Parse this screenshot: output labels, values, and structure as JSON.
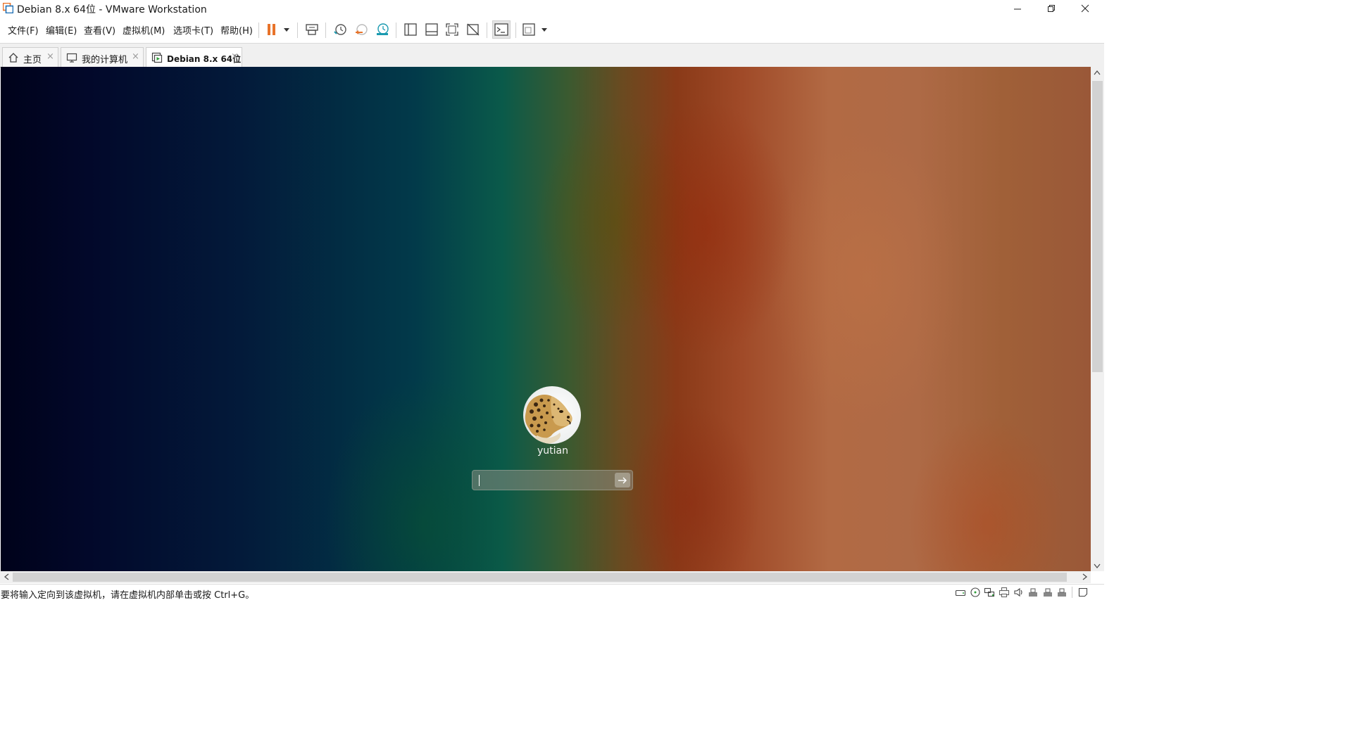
{
  "window": {
    "title": "Debian 8.x 64位 - VMware Workstation"
  },
  "menu": {
    "items": [
      "文件(F)",
      "编辑(E)",
      "查看(V)",
      "虚拟机(M)",
      "选项卡(T)",
      "帮助(H)"
    ]
  },
  "tabs": [
    {
      "label": "主页",
      "icon": "home-icon",
      "close": "×"
    },
    {
      "label": "我的计算机",
      "icon": "monitor-icon",
      "close": "×"
    },
    {
      "label": "Debian 8.x 64位",
      "icon": "vm-icon",
      "close": "×",
      "active": true
    }
  ],
  "vm": {
    "username": "yutian",
    "password_value": "",
    "login_arrow": "→"
  },
  "status": {
    "text": "要将输入定向到该虚拟机，请在虚拟机内部单击或按 Ctrl+G。"
  },
  "colors": {
    "pause_orange": "#e8732a",
    "snapshot_teal": "#1a9ab0"
  }
}
